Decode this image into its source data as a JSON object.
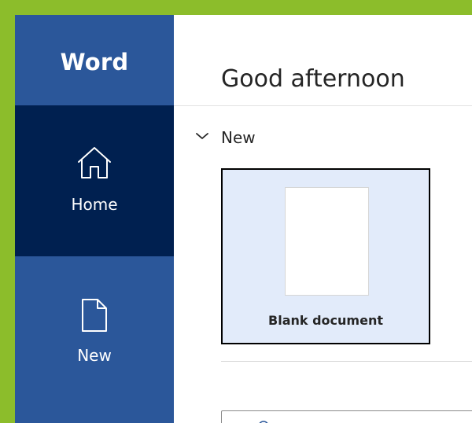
{
  "app": {
    "title": "Word"
  },
  "sidebar": {
    "items": [
      {
        "label": "Home",
        "icon": "home-icon",
        "selected": true
      },
      {
        "label": "New",
        "icon": "new-document-icon",
        "selected": false
      }
    ]
  },
  "main": {
    "greeting": "Good afternoon",
    "new_section": {
      "title": "New",
      "expanded": true,
      "templates": [
        {
          "label": "Blank document",
          "selected": true
        }
      ]
    },
    "search": {
      "icon": "search-icon"
    }
  },
  "colors": {
    "sidebar": "#2b579a",
    "sidebar_selected": "#002050",
    "frame_accent": "#8cbd2b",
    "card_selected_bg": "#e2ebfa",
    "text": "#252525"
  }
}
